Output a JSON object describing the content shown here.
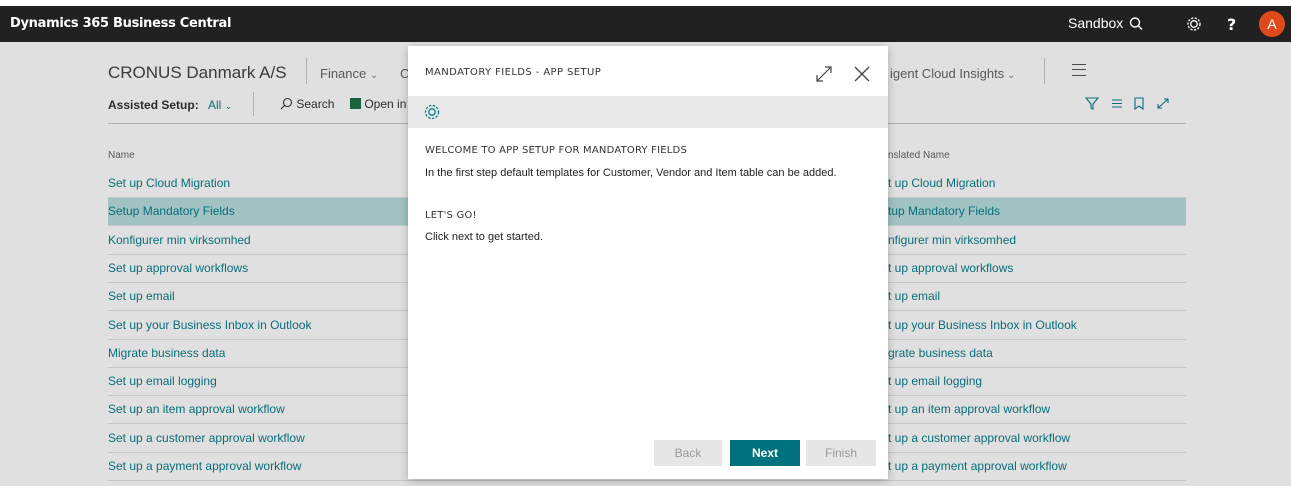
{
  "topbar": {
    "brand": "Dynamics 365 Business Central",
    "env": "Sandbox"
  },
  "nav": {
    "company": "CRONUS Danmark A/S",
    "finance": "Finance",
    "cash_partial": "C",
    "insights_partial": "igent Cloud Insights"
  },
  "actionbar": {
    "assisted_label": "Assisted Setup:",
    "filter_value": "All",
    "search": "Search",
    "open_partial": "Open in"
  },
  "table": {
    "col_name": "Name",
    "col_translated": "nslated Name",
    "rows": [
      {
        "name": "Set up Cloud Migration",
        "translated": "t up Cloud Migration"
      },
      {
        "name": "Setup Mandatory Fields",
        "translated": "tup Mandatory Fields"
      },
      {
        "name": "Konfigurer min virksomhed",
        "translated": "nfigurer min virksomhed"
      },
      {
        "name": "Set up approval workflows",
        "translated": "t up approval workflows"
      },
      {
        "name": "Set up email",
        "translated": "t up email"
      },
      {
        "name": "Set up your Business Inbox in Outlook",
        "translated": "t up your Business Inbox in Outlook"
      },
      {
        "name": "Migrate business data",
        "translated": "grate business data"
      },
      {
        "name": "Set up email logging",
        "translated": "t up email logging"
      },
      {
        "name": "Set up an item approval workflow",
        "translated": "t up an item approval workflow"
      },
      {
        "name": "Set up a customer approval workflow",
        "translated": "t up a customer approval workflow"
      },
      {
        "name": "Set up a payment approval workflow",
        "translated": "t up a payment approval workflow"
      }
    ]
  },
  "dialog": {
    "title": "MANDATORY FIELDS - APP SETUP",
    "welcome_heading": "WELCOME TO APP SETUP FOR MANDATORY FIELDS",
    "welcome_text": "In the first step default templates for Customer, Vendor and Item table can be added.",
    "letsgo_heading": "LET'S GO!",
    "letsgo_text": "Click next to get started.",
    "back": "Back",
    "next": "Next",
    "finish": "Finish"
  },
  "colors": {
    "topbar": "#212121",
    "accent": "#00727d",
    "link": "#0a7e8c",
    "selected_row": "#b9dedf",
    "avatar": "#e04a1a"
  },
  "icons": [
    "search-icon",
    "settings-gear-icon",
    "help-icon",
    "avatar",
    "hamburger-menu-icon",
    "filter-icon",
    "list-view-icon",
    "bookmark-icon",
    "expand-icon",
    "close-icon",
    "excel-icon",
    "chevron-down-icon"
  ]
}
